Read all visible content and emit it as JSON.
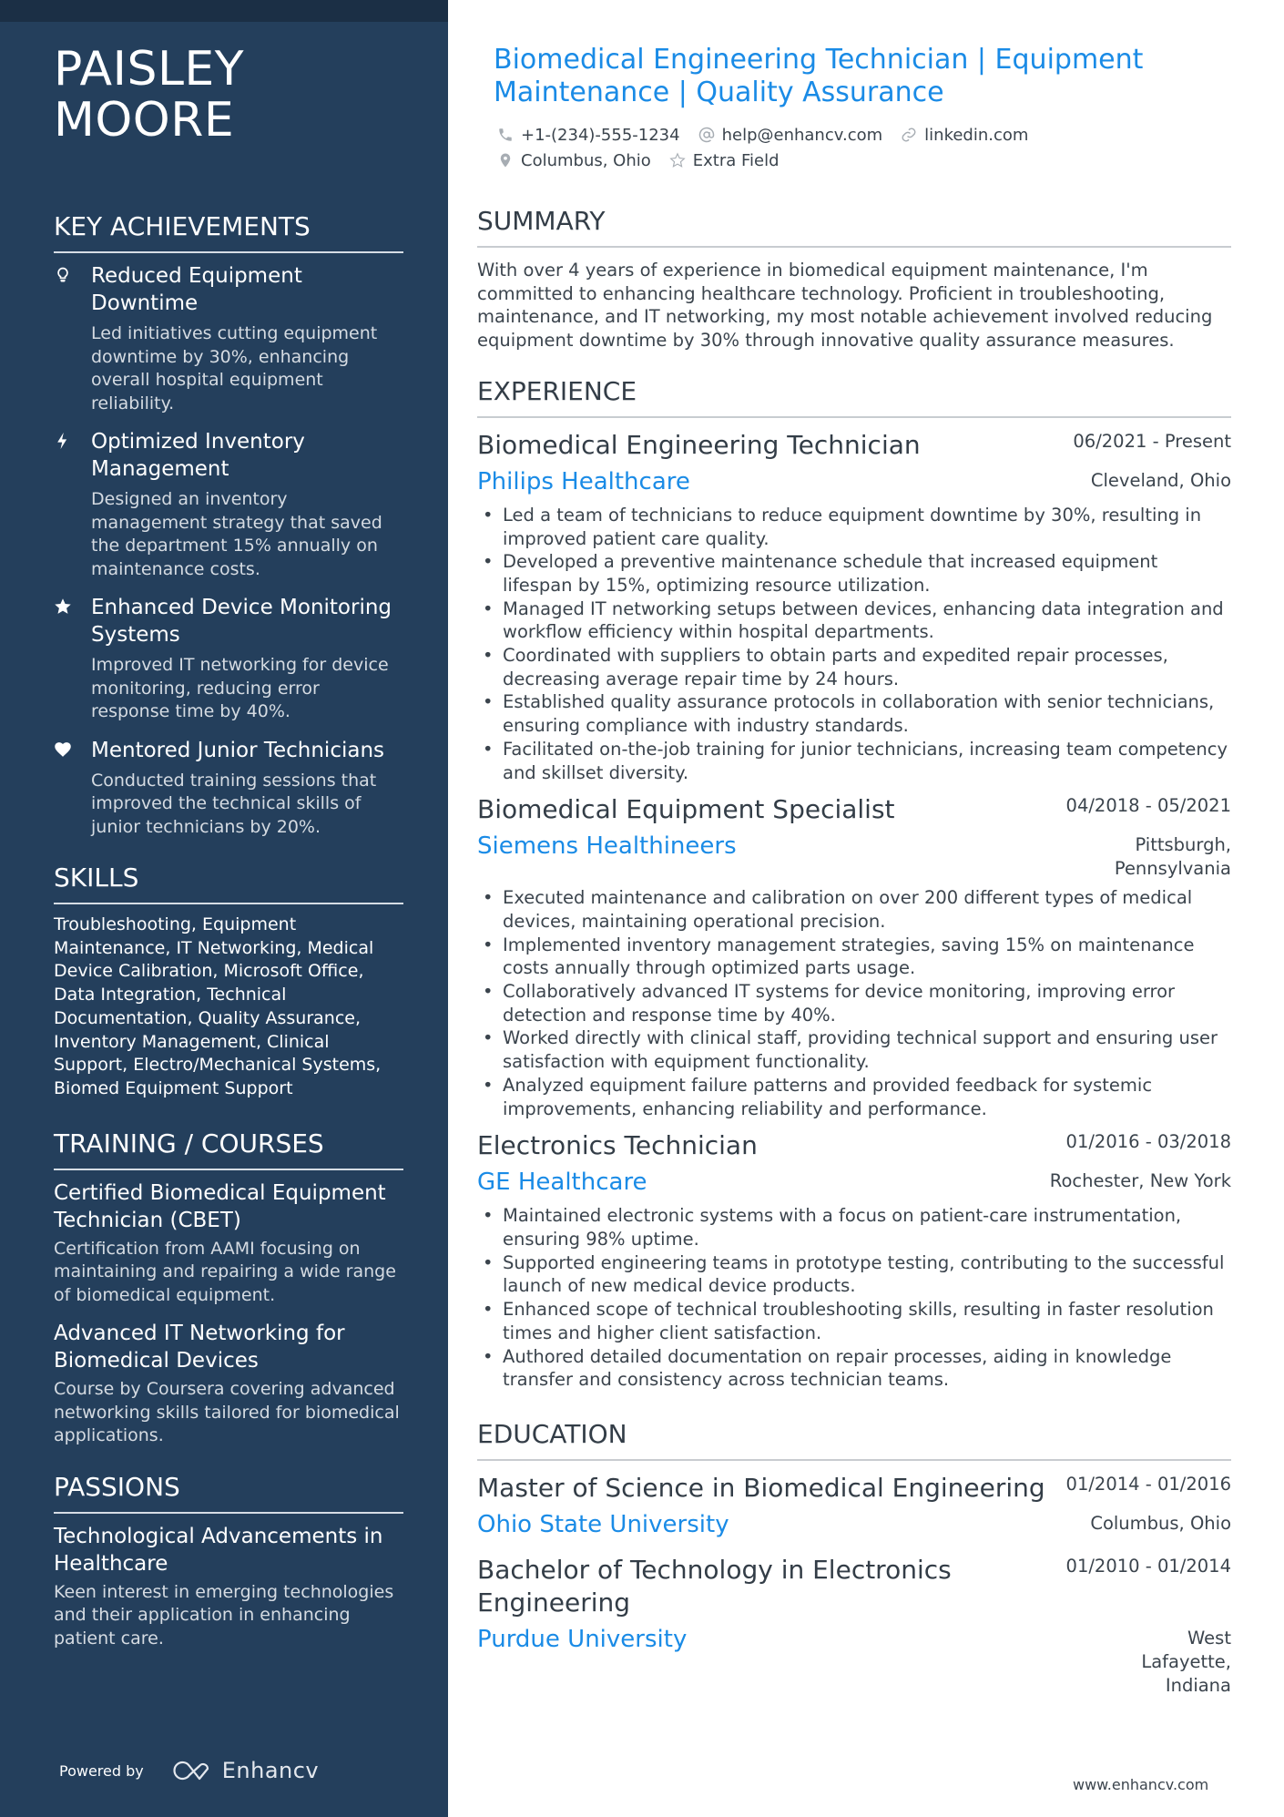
{
  "sidebar": {
    "name_line1": "PAISLEY",
    "name_line2": "MOORE",
    "achievements_heading": "KEY ACHIEVEMENTS",
    "achievements": [
      {
        "icon": "lightbulb-icon",
        "title": "Reduced Equipment Downtime",
        "desc": "Led initiatives cutting equipment downtime by 30%, enhancing overall hospital equipment reliability."
      },
      {
        "icon": "lightning-icon",
        "title": "Optimized Inventory Management",
        "desc": "Designed an inventory management strategy that saved the department 15% annually on maintenance costs."
      },
      {
        "icon": "star-icon",
        "title": "Enhanced Device Monitoring Systems",
        "desc": "Improved IT networking for device monitoring, reducing error response time by 40%."
      },
      {
        "icon": "heart-icon",
        "title": "Mentored Junior Technicians",
        "desc": "Conducted training sessions that improved the technical skills of junior technicians by 20%."
      }
    ],
    "skills_heading": "SKILLS",
    "skills_text": "Troubleshooting, Equipment Maintenance, IT Networking, Medical Device Calibration, Microsoft Office, Data Integration, Technical Documentation, Quality Assurance, Inventory Management, Clinical Support, Electro/Mechanical Systems, Biomed Equipment Support",
    "training_heading": "TRAINING / COURSES",
    "training": [
      {
        "title": "Certified Biomedical Equipment Technician (CBET)",
        "desc": "Certification from AAMI focusing on maintaining and repairing a wide range of biomedical equipment."
      },
      {
        "title": "Advanced IT Networking for Biomedical Devices",
        "desc": "Course by Coursera covering advanced networking skills tailored for biomedical applications."
      }
    ],
    "passions_heading": "PASSIONS",
    "passions": [
      {
        "title": "Technological Advancements in Healthcare",
        "desc": "Keen interest in emerging technologies and their application in enhancing patient care."
      }
    ],
    "powered_by": "Powered by",
    "brand": "Enhancv"
  },
  "header": {
    "headline": "Biomedical Engineering Technician | Equipment Maintenance | Quality Assurance",
    "phone": "+1-(234)-555-1234",
    "email": "help@enhancv.com",
    "linkedin": "linkedin.com",
    "location": "Columbus, Ohio",
    "extra": "Extra Field"
  },
  "summary": {
    "heading": "SUMMARY",
    "text": "With over 4 years of experience in biomedical equipment maintenance, I'm committed to enhancing healthcare technology. Proficient in troubleshooting, maintenance, and IT networking, my most notable achievement involved reducing equipment downtime by 30% through innovative quality assurance measures."
  },
  "experience": {
    "heading": "EXPERIENCE",
    "jobs": [
      {
        "title": "Biomedical Engineering Technician",
        "dates": "06/2021 - Present",
        "company": "Philips Healthcare",
        "location": "Cleveland, Ohio",
        "bullets": [
          "Led a team of technicians to reduce equipment downtime by 30%, resulting in improved patient care quality.",
          "Developed a preventive maintenance schedule that increased equipment lifespan by 15%, optimizing resource utilization.",
          "Managed IT networking setups between devices, enhancing data integration and workflow efficiency within hospital departments.",
          "Coordinated with suppliers to obtain parts and expedited repair processes, decreasing average repair time by 24 hours.",
          "Established quality assurance protocols in collaboration with senior technicians, ensuring compliance with industry standards.",
          "Facilitated on-the-job training for junior technicians, increasing team competency and skillset diversity."
        ]
      },
      {
        "title": "Biomedical Equipment Specialist",
        "dates": "04/2018 - 05/2021",
        "company": "Siemens Healthineers",
        "location": "Pittsburgh, Pennsylvania",
        "bullets": [
          "Executed maintenance and calibration on over 200 different types of medical devices, maintaining operational precision.",
          "Implemented inventory management strategies, saving 15% on maintenance costs annually through optimized parts usage.",
          "Collaboratively advanced IT systems for device monitoring, improving error detection and response time by 40%.",
          "Worked directly with clinical staff, providing technical support and ensuring user satisfaction with equipment functionality.",
          "Analyzed equipment failure patterns and provided feedback for systemic improvements, enhancing reliability and performance."
        ]
      },
      {
        "title": "Electronics Technician",
        "dates": "01/2016 - 03/2018",
        "company": "GE Healthcare",
        "location": "Rochester, New York",
        "bullets": [
          "Maintained electronic systems with a focus on patient-care instrumentation, ensuring 98% uptime.",
          "Supported engineering teams in prototype testing, contributing to the successful launch of new medical device products.",
          "Enhanced scope of technical troubleshooting skills, resulting in faster resolution times and higher client satisfaction.",
          "Authored detailed documentation on repair processes, aiding in knowledge transfer and consistency across technician teams."
        ]
      }
    ]
  },
  "education": {
    "heading": "EDUCATION",
    "items": [
      {
        "degree": "Master of Science in Biomedical Engineering",
        "dates": "01/2014 - 01/2016",
        "school": "Ohio State University",
        "location": "Columbus, Ohio"
      },
      {
        "degree": "Bachelor of Technology in Electronics Engineering",
        "dates": "01/2010 - 01/2014",
        "school": "Purdue University",
        "location": "West Lafayette, Indiana"
      }
    ]
  },
  "footer": {
    "url": "www.enhancv.com"
  }
}
